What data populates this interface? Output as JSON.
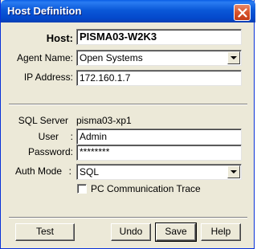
{
  "window": {
    "title": "Host Definition",
    "close_icon": "close-icon"
  },
  "host": {
    "label": "Host:",
    "value": "PISMA03-W2K3"
  },
  "agent_name": {
    "label": "Agent Name:",
    "value": "Open Systems"
  },
  "ip_address": {
    "label": "IP Address:",
    "value": "172.160.1.7"
  },
  "sql_server": {
    "label": "SQL Server",
    "value": "pisma03-xp1"
  },
  "user": {
    "label": "User",
    "colon": ":",
    "value": "Admin"
  },
  "password": {
    "label": "Password:",
    "value": "********"
  },
  "auth_mode": {
    "label": "Auth Mode",
    "colon": ":",
    "value": "SQL"
  },
  "pc_trace": {
    "label": "PC Communication Trace",
    "checked": false
  },
  "buttons": {
    "test": "Test",
    "undo": "Undo",
    "save": "Save",
    "help": "Help"
  },
  "colors": {
    "titlebar": "#0a58d8",
    "dialog_bg": "#ece9d8",
    "close_button": "#d8542c"
  }
}
